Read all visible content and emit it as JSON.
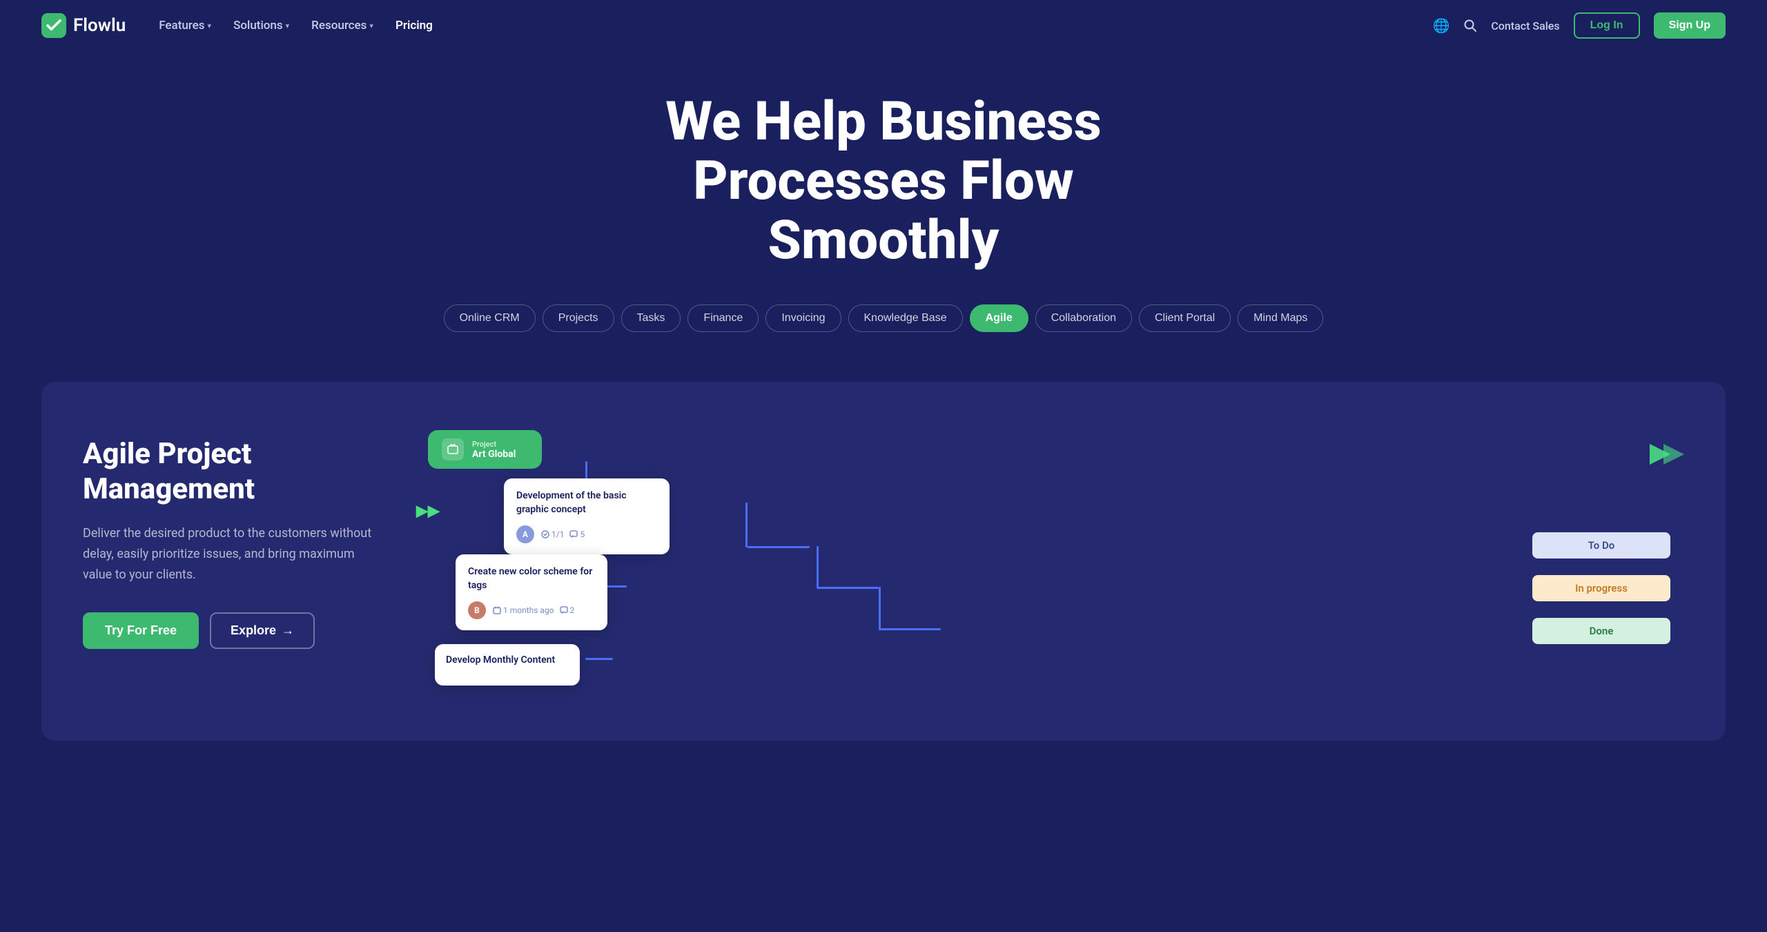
{
  "logo": {
    "name": "Flowlu",
    "icon": "✓"
  },
  "nav": {
    "links": [
      {
        "label": "Features",
        "has_dropdown": true
      },
      {
        "label": "Solutions",
        "has_dropdown": true
      },
      {
        "label": "Resources",
        "has_dropdown": true
      },
      {
        "label": "Pricing",
        "has_dropdown": false,
        "active": true
      }
    ],
    "contact_sales": "Contact Sales",
    "login": "Log In",
    "signup": "Sign Up"
  },
  "hero": {
    "title": "We Help Business Processes Flow Smoothly"
  },
  "tabs": [
    {
      "label": "Online CRM",
      "active": false
    },
    {
      "label": "Projects",
      "active": false
    },
    {
      "label": "Tasks",
      "active": false
    },
    {
      "label": "Finance",
      "active": false
    },
    {
      "label": "Invoicing",
      "active": false
    },
    {
      "label": "Knowledge Base",
      "active": false
    },
    {
      "label": "Agile",
      "active": true
    },
    {
      "label": "Collaboration",
      "active": false
    },
    {
      "label": "Client Portal",
      "active": false
    },
    {
      "label": "Mind Maps",
      "active": false
    }
  ],
  "card": {
    "title": "Agile Project Management",
    "description": "Deliver the desired product to the customers without delay, easily prioritize issues, and bring maximum value to your clients.",
    "try_free": "Try For Free",
    "explore": "Explore",
    "explore_arrow": "→"
  },
  "visual": {
    "project": {
      "label": "Project",
      "name": "Art Global"
    },
    "task1": {
      "title": "Development of the basic graphic concept",
      "subtasks": "1/1",
      "comments": "5"
    },
    "task2": {
      "title": "Create new color scheme for tags",
      "date": "1 months ago",
      "comments": "2"
    },
    "task3": {
      "title": "Develop Monthly Content"
    },
    "kanban": {
      "todo": "To Do",
      "inprogress": "In progress",
      "done": "Done"
    }
  },
  "colors": {
    "bg_dark": "#1a1f5e",
    "bg_card": "#252a70",
    "green": "#3dba6f",
    "blue_connector": "#4a6fff"
  }
}
